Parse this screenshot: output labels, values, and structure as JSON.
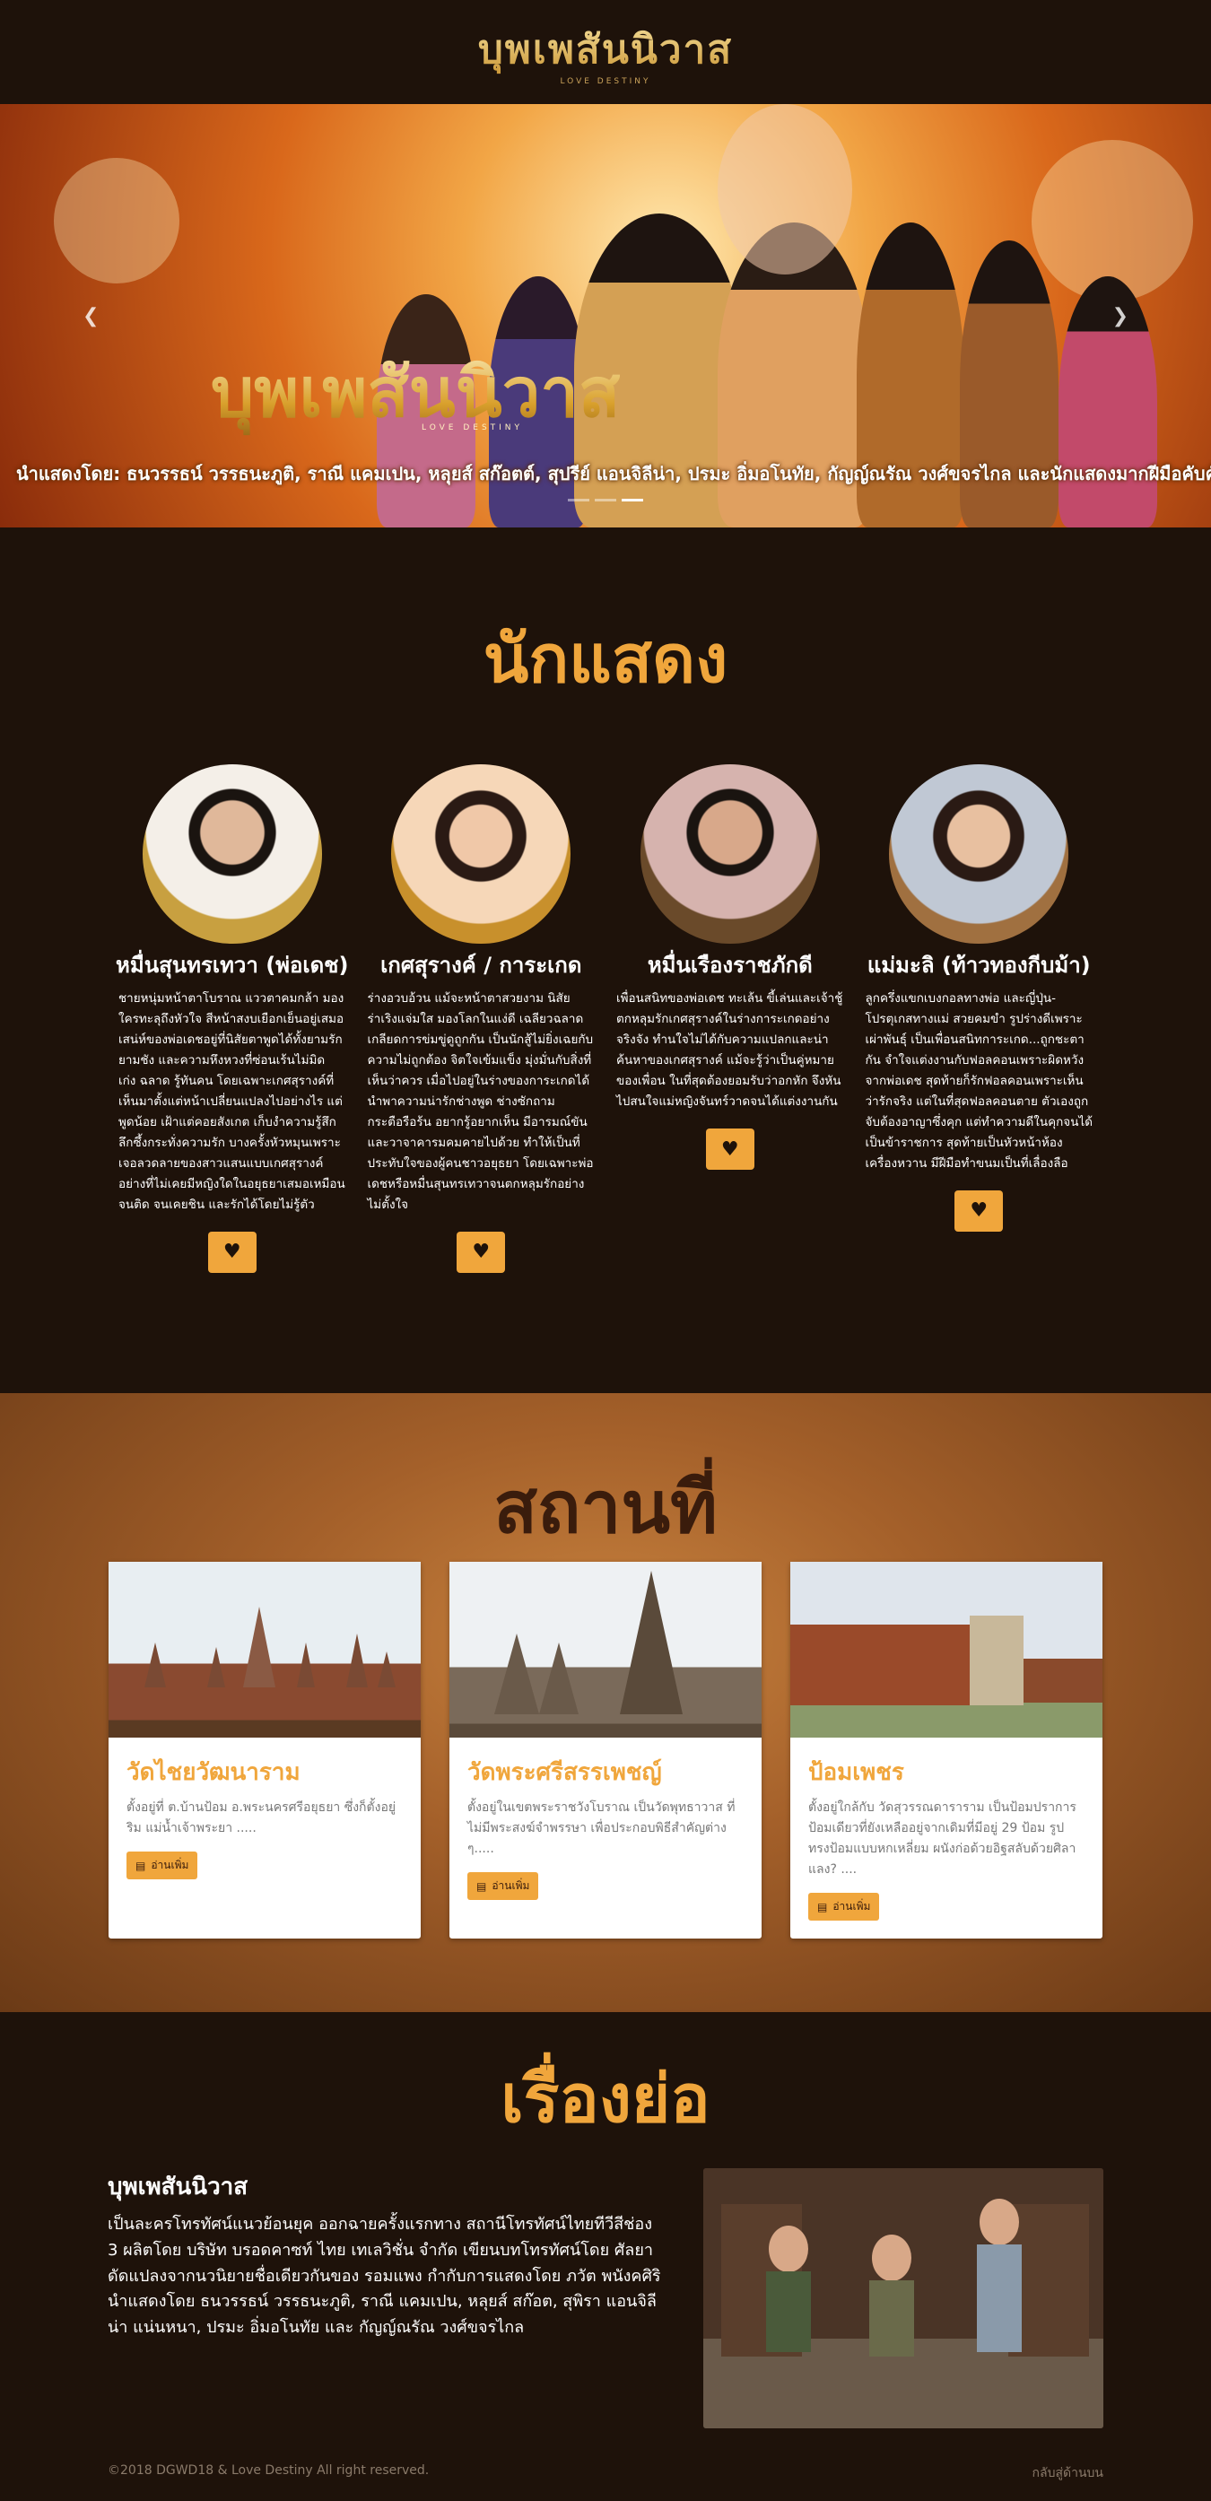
{
  "header": {
    "logo_title": "บุพเพสันนิวาส",
    "logo_sub": "LOVE DESTINY"
  },
  "hero": {
    "title": "บุพเพสันนิวาส",
    "title_sub": "LOVE DESTINY",
    "cast": "นำแสดงโดย: ธนวรรธน์ วรรธนะภูติ, ราณี แคมเปน, หลุยส์ สก๊อตต์, สุปรีย์ แอนจิลีน่า, ปรมะ อิ่มอโนทัย, กัญญ์ณรัณ วงศ์ขจรไกล และนักแสดงมากฝีมือคับคั่ง",
    "prev_icon": "chevron-left-icon",
    "next_icon": "chevron-right-icon",
    "slides": 3,
    "active_slide": 2
  },
  "actors": {
    "title": "นักแสดง",
    "items": [
      {
        "name": "หมื่นสุนทรเทวา (พ่อเดช)",
        "desc": "ชายหนุ่มหน้าตาโบราณ แววตาคมกล้า มองใครทะลุถึงหัวใจ สีหน้าสงบเยือกเย็นอยู่เสมอ เสน่ห์ของพ่อเดชอยู่ที่นิสัยตาพูดได้ทั้งยามรักยามชัง และความหึงหวงที่ซ่อนเร้นไม่มิด เก่ง ฉลาด รู้ทันคน โดยเฉพาะเกศสุรางค์ที่เห็นมาตั้งแต่หน้าเปลี่ยนแปลงไปอย่างไร แต่พูดน้อย เฝ้าแต่คอยสังเกต เก็บงำความรู้สึกลึกซึ้งกระทั่งความรัก บางครั้งหัวหมุนเพราะเจอลวดลายของสาวแสนแบบเกศสุรางค์ อย่างที่ไม่เคยมีหญิงใดในอยุธยาเสมอเหมือน จนติด จนเคยชิน และรักได้โดยไม่รู้ตัว"
      },
      {
        "name": "เกศสุรางค์ / การะเกด",
        "desc": "ร่างอวบอ้วน แม้จะหน้าตาสวยงาม นิสัยร่าเริงแจ่มใส มองโลกในแง่ดี เฉลียวฉลาด เกลียดการข่มขู่ดูถูกกัน เป็นนักสู้ไม่ยิ่งเฉยกับความไม่ถูกต้อง จิตใจเข้มแข็ง มุ่งมั่นกับสิ่งที่เห็นว่าควร เมื่อไปอยู่ในร่างของการะเกดได้นำพาความน่ารักช่างพูด ช่างซักถาม กระตือรือร้น อยากรู้อยากเห็น มีอารมณ์ขัน และวาจาคารมคมคายไปด้วย ทำให้เป็นที่ประทับใจของผู้คนชาวอยุธยา โดยเฉพาะพ่อเดชหรือหมื่นสุนทรเทวาจนตกหลุมรักอย่างไม่ตั้งใจ"
      },
      {
        "name": "หมื่นเรืองราชภักดี",
        "desc": "เพื่อนสนิทของพ่อเดช ทะเล้น ขี้เล่นและเจ้าชู้ ตกหลุมรักเกศสุรางค์ในร่างการะเกดอย่างจริงจัง ทำนใจไม่ได้กับความแปลกและน่าค้นหาของเกศสุรางค์ แม้จะรู้ว่าเป็นคู่หมายของเพื่อน ในที่สุดต้องยอมรับว่าอกหัก จึงหันไปสนใจแม่หญิงจันทร์วาดจนได้แต่งงานกัน"
      },
      {
        "name": "แม่มะลิ (ท้าวทองกีบม้า)",
        "desc": "ลูกครึ่งแขกเบงกอลทางพ่อ และญี่ปุ่น-โปรตุเกสทางแม่ สวยคมขำ รูปร่างดีเพราะเผ่าพันธุ์ เป็นเพื่อนสนิทการะเกด...ถูกชะตากัน จำใจแต่งงานกับฟอลคอนเพราะผิดหวังจากพ่อเดช สุดท้ายก็รักฟอลคอนเพราะเห็นว่ารักจริง แต่ในที่สุดฟอลคอนตาย ตัวเองถูกจับต้องอาญาซึ่งคุก แต่ทำความดีในคุกจนได้เป็นข้าราชการ สุดท้ายเป็นหัวหน้าห้องเครื่องหวาน มีฝีมือทำขนมเป็นที่เลื่องลือ"
      }
    ]
  },
  "places": {
    "title": "สถานที่",
    "items": [
      {
        "name": "วัดไชยวัฒนาราม",
        "desc": "ตั้งอยู่ที่ ต.บ้านป้อม อ.พระนครศรีอยุธยา ซึ่งก็ตั้งอยู่ริม แม่น้ำเจ้าพระยา .....",
        "button": "อ่านเพิ่ม"
      },
      {
        "name": "วัดพระศรีสรรเพชญ์",
        "desc": "ตั้งอยู่ในเขตพระราชวังโบราณ เป็นวัดพุทธาวาส ที่ไม่มีพระสงฆ์จำพรรษา เพื่อประกอบพิธีสำคัญต่าง ๆ.....",
        "button": "อ่านเพิ่ม"
      },
      {
        "name": "ป้อมเพชร",
        "desc": "ตั้งอยู่ใกล้กับ วัดสุวรรณดาราราม เป็นป้อมปราการป้อมเดียวที่ยังเหลืออยู่จากเดิมที่มีอยู่ 29 ป้อม รูปทรงป้อมแบบหกเหลี่ยม ผนังก่อด้วยอิฐสลับด้วยศิลาแลง? ....",
        "button": "อ่านเพิ่ม"
      }
    ]
  },
  "synopsis": {
    "title": "เรื่องย่อ",
    "heading": "บุพเพสันนิวาส",
    "body": "เป็นละครโทรทัศน์แนวย้อนยุค ออกฉายครั้งแรกทาง สถานีโทรทัศน์ไทยทีวีสีช่อง 3 ผลิตโดย บริษัท บรอดคาซท์ ไทย เทเลวิชั่น จำกัด เขียนบทโทรทัศน์โดย ศัลยา ดัดแปลงจากนวนิยายชื่อเดียวกันของ รอมแพง กำกับการแสดงโดย ภวัต พนังคศิริ นำแสดงโดย ธนวรรธน์ วรรธนะภูติ, ราณี แคมเปน, หลุยส์ สก๊อต, สุพิรา แอนจิลีน่า แน่นหนา, ปรมะ อิ่มอโนทัย และ กัญญ์ณรัณ วงศ์ขจรไกล"
  },
  "footer": {
    "copyright": "©2018 DGWD18 & Love Destiny All right reserved.",
    "back_home": "กลับสู่ด้านบน"
  },
  "colors": {
    "accent": "#f0a63c",
    "dark_bg": "#1e120a",
    "place_title": "#3a1c0c"
  }
}
